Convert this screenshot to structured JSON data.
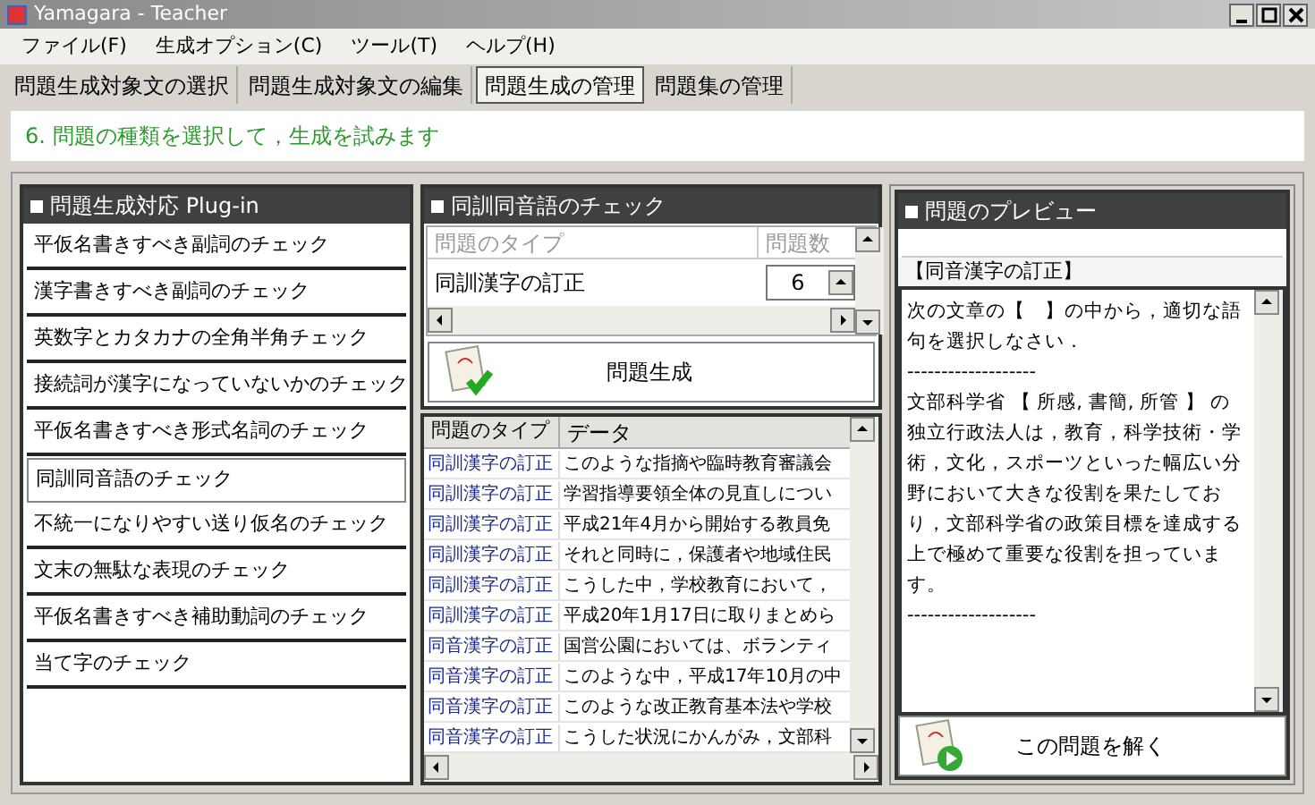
{
  "window": {
    "title": "Yamagara - Teacher"
  },
  "menu": [
    "ファイル(F)",
    "生成オプション(C)",
    "ツール(T)",
    "ヘルプ(H)"
  ],
  "tabs": [
    {
      "label": "問題生成対象文の選択",
      "selected": false
    },
    {
      "label": "問題生成対象文の編集",
      "selected": false
    },
    {
      "label": "問題生成の管理",
      "selected": true
    },
    {
      "label": "問題集の管理",
      "selected": false
    }
  ],
  "instruction": "6. 問題の種類を選択して，生成を試みます",
  "plugins": {
    "title": "問題生成対応 Plug-in",
    "items": [
      {
        "label": "平仮名書きすべき副詞のチェック",
        "selected": false
      },
      {
        "label": "漢字書きすべき副詞のチェック",
        "selected": false
      },
      {
        "label": "英数字とカタカナの全角半角チェック",
        "selected": false
      },
      {
        "label": "接続詞が漢字になっていないかのチェック",
        "selected": false
      },
      {
        "label": "平仮名書きすべき形式名詞のチェック",
        "selected": false
      },
      {
        "label": "同訓同音語のチェック",
        "selected": true
      },
      {
        "label": "不統一になりやすい送り仮名のチェック",
        "selected": false
      },
      {
        "label": "文末の無駄な表現のチェック",
        "selected": false
      },
      {
        "label": "平仮名書きすべき補助動詞のチェック",
        "selected": false
      },
      {
        "label": "当て字のチェック",
        "selected": false
      }
    ]
  },
  "check": {
    "title": "同訓同音語のチェック",
    "columns": [
      "問題のタイプ",
      "問題数"
    ],
    "rows": [
      {
        "type": "同訓漢字の訂正",
        "count": "6"
      }
    ],
    "generate_button": "問題生成",
    "results": {
      "columns": [
        "問題のタイプ",
        "データ"
      ],
      "rows": [
        [
          "同訓漢字の訂正",
          "このような指摘や臨時教育審議会"
        ],
        [
          "同訓漢字の訂正",
          "学習指導要領全体の見直しについ"
        ],
        [
          "同訓漢字の訂正",
          "平成21年4月から開始する教員免"
        ],
        [
          "同訓漢字の訂正",
          "それと同時に，保護者や地域住民"
        ],
        [
          "同訓漢字の訂正",
          "こうした中，学校教育において，"
        ],
        [
          "同訓漢字の訂正",
          "平成20年1月17日に取りまとめら"
        ],
        [
          "同音漢字の訂正",
          "国営公園においては、ボランティ"
        ],
        [
          "同音漢字の訂正",
          "このような中，平成17年10月の中"
        ],
        [
          "同音漢字の訂正",
          "このような改正教育基本法や学校"
        ],
        [
          "同音漢字の訂正",
          "こうした状況にかんがみ，文部科"
        ]
      ]
    }
  },
  "preview": {
    "title": "問題のプレビュー",
    "heading": "【同音漢字の訂正】",
    "paragraphs": [
      "次の文章の【　】の中から，適切な語句を選択しなさい．",
      "-------------------",
      "文部科学省 【 所感, 書簡, 所管 】 の独立行政法人は，教育，科学技術・学術，文化，スポーツといった幅広い分野において大きな役割を果たしており，文部科学省の政策目標を達成する上で極めて重要な役割を担っています。",
      "-------------------"
    ],
    "solve_button": "この問題を解く"
  }
}
